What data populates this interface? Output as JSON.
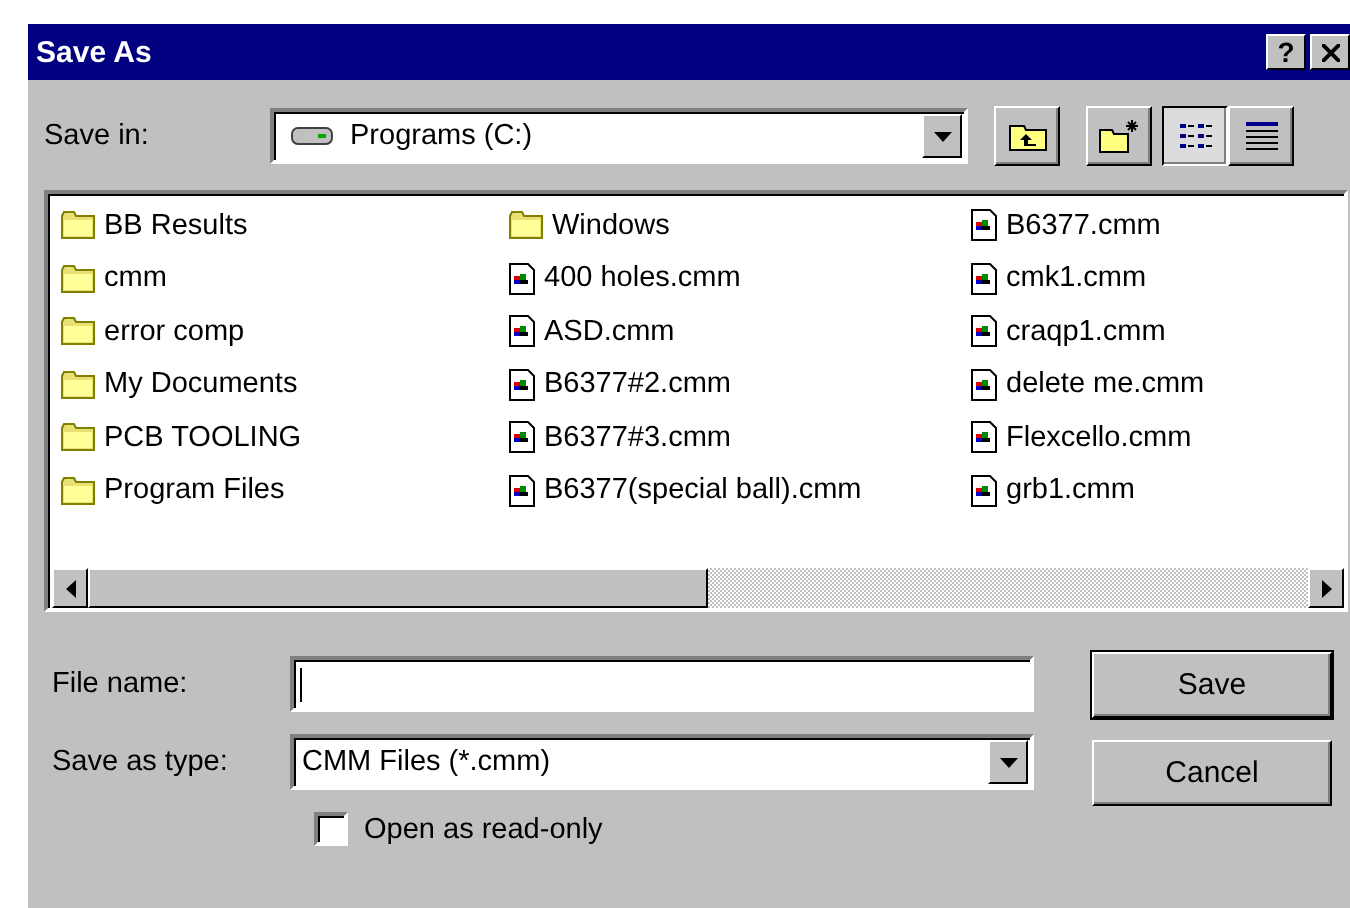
{
  "window": {
    "title": "Save As",
    "help_button": "?"
  },
  "save_in": {
    "label": "Save in:",
    "value": "Programs (C:)"
  },
  "files": [
    {
      "name": "BB Results",
      "kind": "folder"
    },
    {
      "name": "cmm",
      "kind": "folder"
    },
    {
      "name": "error comp",
      "kind": "folder"
    },
    {
      "name": "My Documents",
      "kind": "folder"
    },
    {
      "name": "PCB TOOLING",
      "kind": "folder"
    },
    {
      "name": "Program Files",
      "kind": "folder"
    },
    {
      "name": "Windows",
      "kind": "folder"
    },
    {
      "name": "400 holes.cmm",
      "kind": "file"
    },
    {
      "name": "ASD.cmm",
      "kind": "file"
    },
    {
      "name": "B6377#2.cmm",
      "kind": "file"
    },
    {
      "name": "B6377#3.cmm",
      "kind": "file"
    },
    {
      "name": "B6377(special ball).cmm",
      "kind": "file"
    },
    {
      "name": "B6377.cmm",
      "kind": "file"
    },
    {
      "name": "cmk1.cmm",
      "kind": "file"
    },
    {
      "name": "craqp1.cmm",
      "kind": "file"
    },
    {
      "name": "delete me.cmm",
      "kind": "file"
    },
    {
      "name": "Flexcello.cmm",
      "kind": "file"
    },
    {
      "name": "grb1.cmm",
      "kind": "file"
    }
  ],
  "file_name": {
    "label": "File name:"
  },
  "save_type": {
    "label": "Save as type:",
    "value": "CMM Files (*.cmm)"
  },
  "read_only": {
    "label": "Open as read-only",
    "checked": false
  },
  "buttons": [
    {
      "label": "Save",
      "default": true
    },
    {
      "label": "Cancel",
      "default": false
    }
  ]
}
